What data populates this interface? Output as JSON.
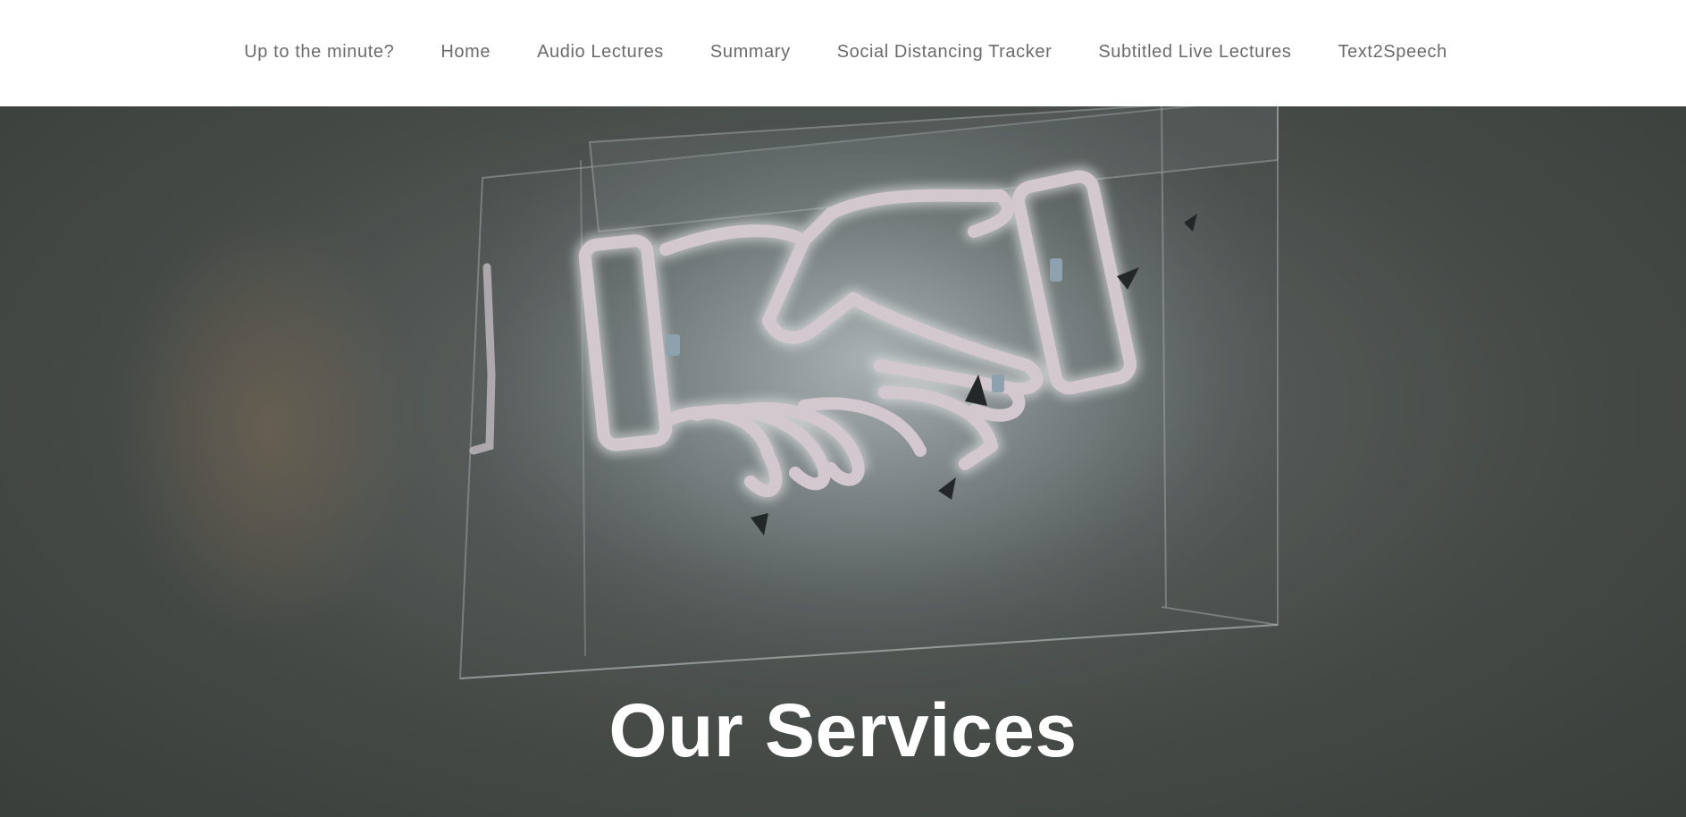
{
  "nav": {
    "items": [
      {
        "label": "Up to the minute?"
      },
      {
        "label": "Home"
      },
      {
        "label": "Audio Lectures"
      },
      {
        "label": "Summary"
      },
      {
        "label": "Social Distancing Tracker"
      },
      {
        "label": "Subtitled Live Lectures"
      },
      {
        "label": "Text2Speech"
      }
    ]
  },
  "hero": {
    "title": "Our Services",
    "image_subject": "neon-handshake-sign"
  },
  "colors": {
    "nav_background": "#ffffff",
    "nav_text": "#6b6b6b",
    "hero_overlay": "#4a4f4b",
    "neon": "#f6e6ee",
    "title_text": "#ffffff"
  }
}
